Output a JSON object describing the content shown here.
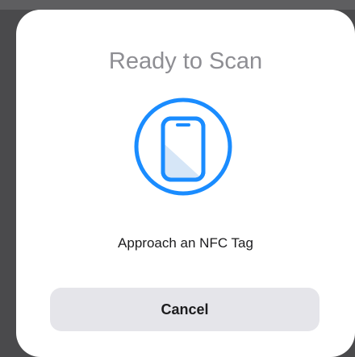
{
  "sheet": {
    "title": "Ready to Scan",
    "graphic_icon": "phone-scan-icon",
    "prompt": "Approach an NFC Tag",
    "cancel_label": "Cancel"
  },
  "colors": {
    "accent": "#1a8cff",
    "title_gray": "#8e8e93",
    "button_bg": "#e5e5ea",
    "sheet_bg": "#ffffff",
    "backdrop": "#4a4a4c"
  }
}
